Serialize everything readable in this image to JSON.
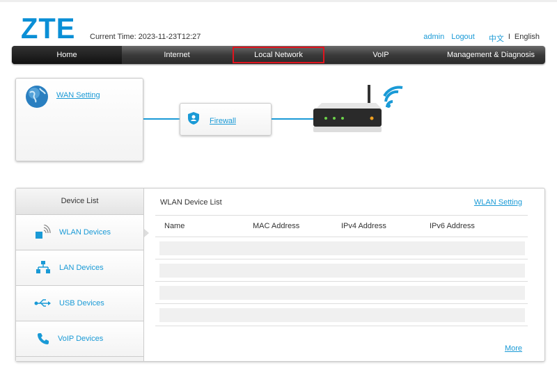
{
  "header": {
    "logo": "ZTE",
    "current_time": "Current Time: 2023-11-23T12:27",
    "user": "admin",
    "logout": "Logout",
    "lang_zh": "中文",
    "lang_sep": "I",
    "lang_en": "English"
  },
  "nav": {
    "tabs": [
      "Home",
      "Internet",
      "Local Network",
      "VoIP",
      "Management & Diagnosis"
    ],
    "active": "Home",
    "highlighted": "Local Network"
  },
  "topology": {
    "wan_setting": "WAN Setting",
    "firewall": "Firewall"
  },
  "device_list": {
    "title": "Device List",
    "items": [
      "WLAN Devices",
      "LAN Devices",
      "USB Devices",
      "VoIP Devices"
    ],
    "selected": "WLAN Devices"
  },
  "wlan_list": {
    "title": "WLAN Device List",
    "setting_link": "WLAN Setting",
    "columns": [
      "Name",
      "MAC Address",
      "IPv4 Address",
      "IPv6 Address"
    ],
    "rows": [],
    "more": "More"
  },
  "colors": {
    "accent": "#1a9ad6",
    "highlight": "#e0141e"
  }
}
